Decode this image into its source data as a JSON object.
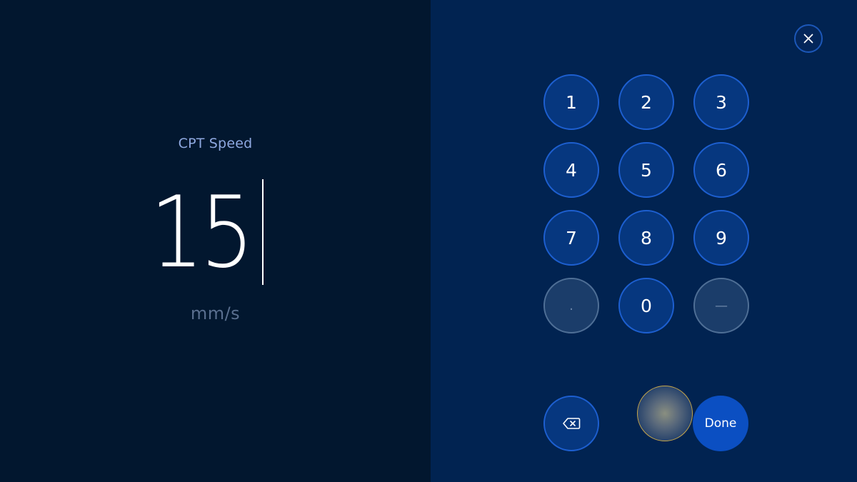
{
  "entry": {
    "label": "CPT Speed",
    "value": "15",
    "unit": "mm/s"
  },
  "keypad": {
    "keys": [
      {
        "label": "1",
        "enabled": true
      },
      {
        "label": "2",
        "enabled": true
      },
      {
        "label": "3",
        "enabled": true
      },
      {
        "label": "4",
        "enabled": true
      },
      {
        "label": "5",
        "enabled": true
      },
      {
        "label": "6",
        "enabled": true
      },
      {
        "label": "7",
        "enabled": true
      },
      {
        "label": "8",
        "enabled": true
      },
      {
        "label": "9",
        "enabled": true
      },
      {
        "label": ".",
        "enabled": false
      },
      {
        "label": "0",
        "enabled": true
      },
      {
        "label": "—",
        "enabled": false
      }
    ],
    "done_label": "Done",
    "backspace_icon": "backspace-icon",
    "close_icon": "close-icon"
  },
  "colors": {
    "left_background": "#02172f",
    "right_background": "#012351",
    "key_fill": "#06377f",
    "key_border": "#1d5fd0",
    "done_fill": "#0b4fc2",
    "label_color": "#8fa9e0"
  }
}
